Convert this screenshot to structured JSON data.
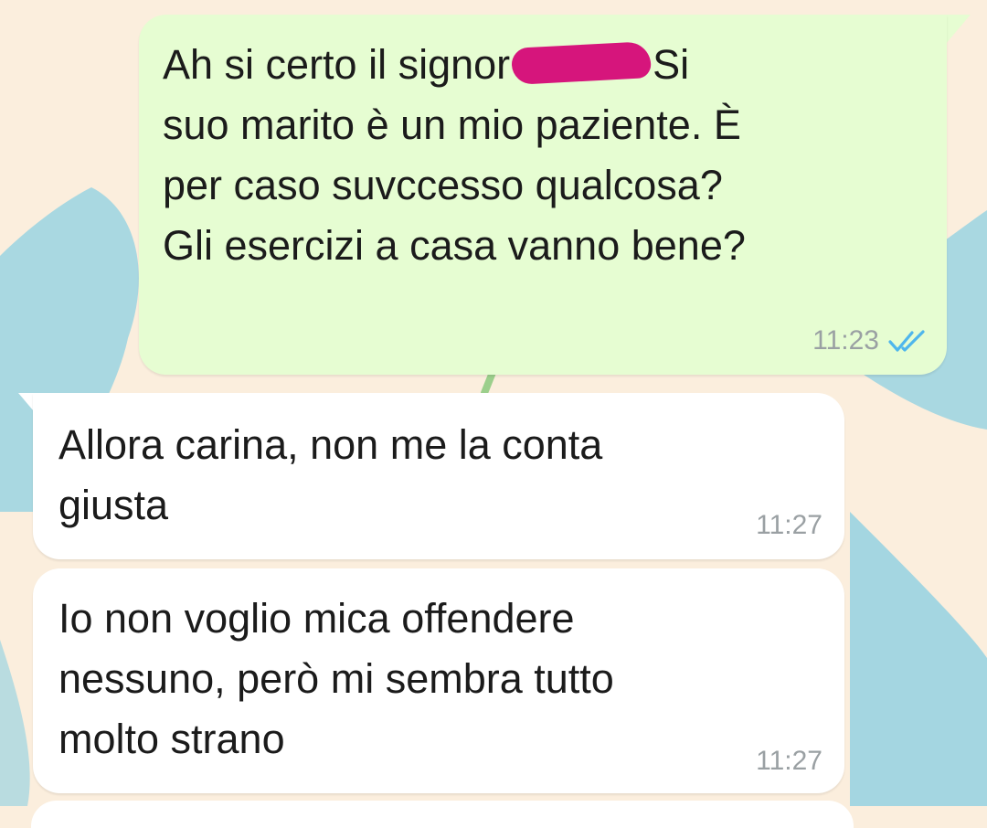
{
  "chat": {
    "messages": [
      {
        "direction": "outgoing",
        "text_before": "Ah si certo il signor",
        "redacted": true,
        "text_after": "Si\nsuo marito è un mio paziente. È\nper caso suvccesso qualcosa?\nGli esercizi a casa vanno bene?",
        "time": "11:23",
        "status_icon": "double-check-read-icon"
      },
      {
        "direction": "incoming",
        "text": "Allora carina, non me la conta\ngiusta",
        "time": "11:27"
      },
      {
        "direction": "incoming",
        "text": "Io non voglio mica offendere\nnessuno, però mi sembra tutto\nmolto strano",
        "time": "11:27"
      }
    ]
  },
  "colors": {
    "outgoing_bubble": "#e6fdd2",
    "incoming_bubble": "#ffffff",
    "background": "#fbeedd",
    "read_ticks": "#4fb6ec",
    "timestamp": "#9aa0a3"
  }
}
